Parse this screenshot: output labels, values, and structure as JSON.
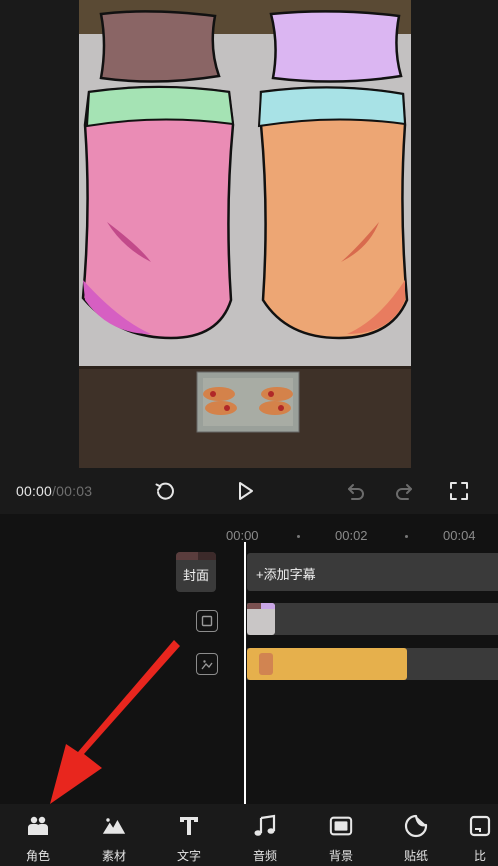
{
  "player": {
    "current_time": "00:00",
    "separator": "/",
    "duration": "00:03"
  },
  "ruler": {
    "labels": [
      "00:00",
      "00:02",
      "00:04"
    ]
  },
  "tracks": {
    "cover_label": "封面",
    "subtitle_placeholder": "+添加字幕"
  },
  "toolbar": {
    "items": [
      {
        "label": "角色",
        "icon": "character-icon"
      },
      {
        "label": "素材",
        "icon": "material-icon"
      },
      {
        "label": "文字",
        "icon": "text-icon"
      },
      {
        "label": "音频",
        "icon": "audio-icon"
      },
      {
        "label": "背景",
        "icon": "background-icon"
      },
      {
        "label": "贴纸",
        "icon": "sticker-icon"
      },
      {
        "label": "比",
        "icon": "ratio-icon"
      }
    ]
  },
  "colors": {
    "accent_arrow": "#e8261e",
    "audio_clip": "#e6b04c",
    "track_bg": "#3a3a3a"
  }
}
